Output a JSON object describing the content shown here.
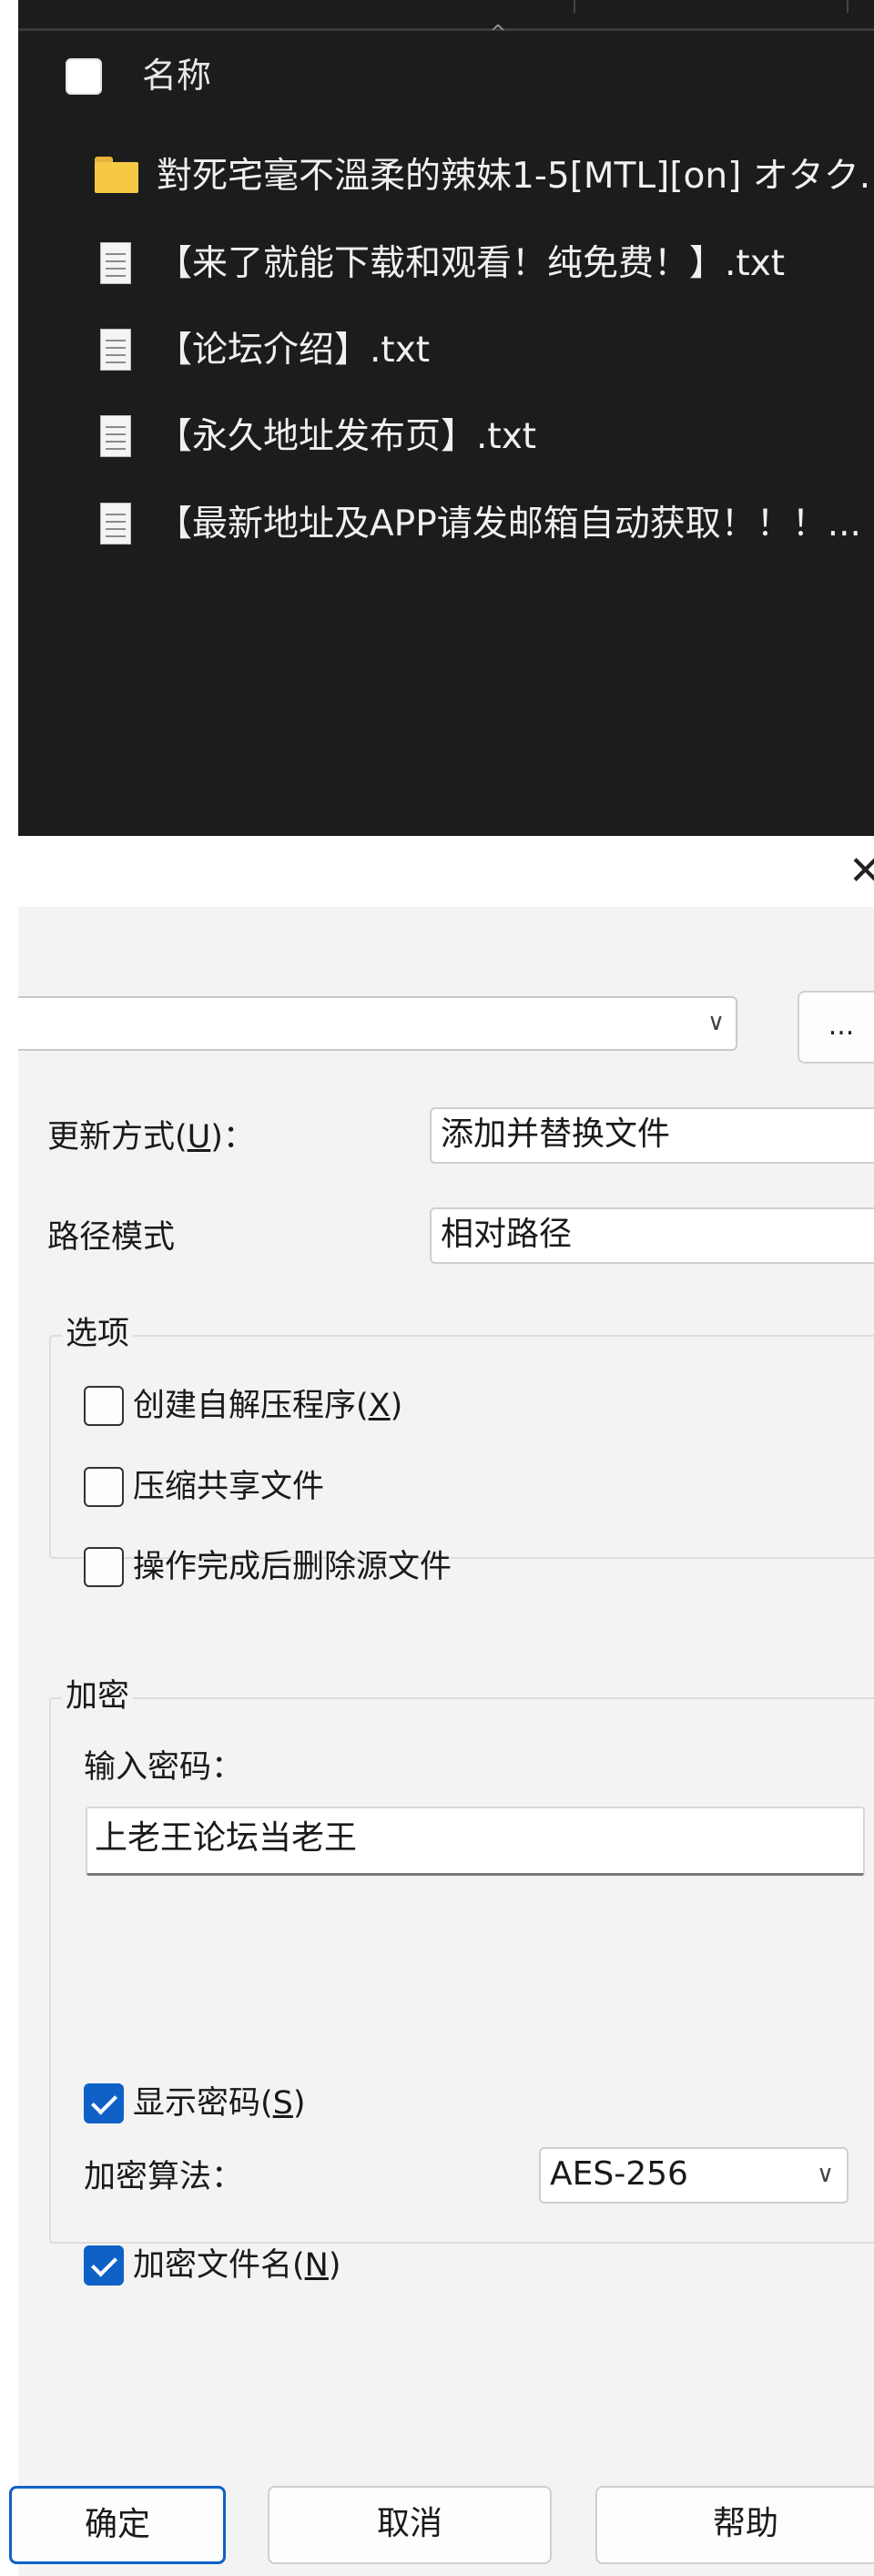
{
  "file_list": {
    "header_label": "名称",
    "rows": [
      {
        "type": "folder",
        "name": "對死宅毫不溫柔的辣妹1-5[MTL][on] オタク..."
      },
      {
        "type": "file",
        "name": "【来了就能下载和观看！纯免费！】.txt"
      },
      {
        "type": "file",
        "name": "【论坛介绍】.txt"
      },
      {
        "type": "file",
        "name": "【永久地址发布页】.txt"
      },
      {
        "type": "file",
        "name": "【最新地址及APP请发邮箱自动获取！！！..."
      }
    ]
  },
  "dialog": {
    "close_icon": "close-icon",
    "archive_name_value": "",
    "browse_label": "...",
    "update_mode": {
      "label": "更新方式(",
      "mnemonic": "U",
      "suffix": ")：",
      "value": "添加并替换文件"
    },
    "path_mode": {
      "label": "路径模式",
      "value": "相对路径"
    },
    "options": {
      "title": "选项",
      "items": [
        {
          "label": "创建自解压程序(",
          "mnemonic": "X",
          "suffix": ")",
          "checked": false
        },
        {
          "label": "压缩共享文件",
          "mnemonic": "",
          "suffix": "",
          "checked": false
        },
        {
          "label": "操作完成后删除源文件",
          "mnemonic": "",
          "suffix": "",
          "checked": false
        }
      ]
    },
    "encryption": {
      "title": "加密",
      "password_label": "输入密码：",
      "password_value": "上老王论坛当老王",
      "show_password": {
        "label": "显示密码(",
        "mnemonic": "S",
        "suffix": ")",
        "checked": true
      },
      "algorithm_label": "加密算法：",
      "algorithm_value": "AES-256",
      "encrypt_names": {
        "label": "加密文件名(",
        "mnemonic": "N",
        "suffix": ")",
        "checked": true
      }
    },
    "buttons": {
      "ok": "确定",
      "cancel": "取消",
      "help": "帮助"
    },
    "accent_color": "#0f61c7"
  }
}
